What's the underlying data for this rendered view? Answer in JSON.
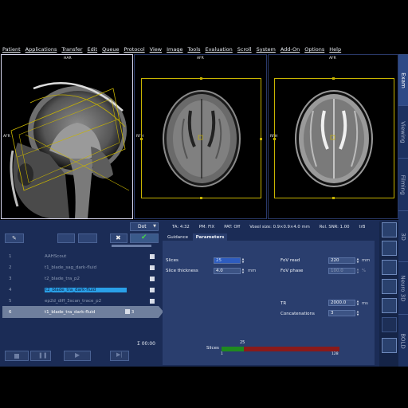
{
  "menu": [
    "Patient",
    "Applications",
    "Transfer",
    "Edit",
    "Queue",
    "Protocol",
    "View",
    "Image",
    "Tools",
    "Evaluation",
    "Scroll",
    "System",
    "Add-On",
    "Options",
    "Help"
  ],
  "viewports": {
    "v1": {
      "top": "HAR",
      "left": "AFR"
    },
    "v2": {
      "top": "AFR",
      "left": "RFH"
    },
    "v3": {
      "top": "AFR",
      "left": "RFH"
    }
  },
  "right_tabs": [
    "Exam",
    "Viewing",
    "Filming",
    "3D",
    "Neuro 3D",
    "BOLD"
  ],
  "queue": {
    "dot_label": "Dot",
    "rows": [
      {
        "num": "1",
        "name": "AAHScout"
      },
      {
        "num": "2",
        "name": "t1_blade_sag_dark-fluid"
      },
      {
        "num": "3",
        "name": "t2_blade_tra_p2"
      },
      {
        "num": "4",
        "name": "t2_blade_tra_dark-fluid"
      },
      {
        "num": "5",
        "name": "ep2d_diff_3scan_trace_p2"
      },
      {
        "num": "6",
        "name": "t1_blade_tra_dark-fluid",
        "suffix": "3"
      }
    ],
    "total_time": "Σ 00:00"
  },
  "status": {
    "ta": "TA: 4:32",
    "pm": "PM: FIX",
    "pat": "PAT: Off",
    "voxel": "Voxel size: 0.9×0.9×4.0 mm",
    "snr": "Rel. SNR: 1.00",
    "seq": "trB"
  },
  "subtabs": {
    "guidance": "Guidance",
    "parameters": "Parameters"
  },
  "params": {
    "slices_label": "Slices",
    "slices_value": "25",
    "thickness_label": "Slice thickness",
    "thickness_value": "4.0",
    "thickness_unit": "mm",
    "fov_read_label": "FoV read",
    "fov_read_value": "220",
    "fov_read_unit": "mm",
    "fov_phase_label": "FoV phase",
    "fov_phase_value": "100.0",
    "fov_phase_unit": "%",
    "tr_label": "TR",
    "tr_value": "2000.0",
    "tr_unit": "ms",
    "conc_label": "Concatenations",
    "conc_value": "3"
  },
  "slider": {
    "label": "Slices",
    "value": "25",
    "min": "1",
    "max": "128",
    "fraction": 0.19
  },
  "colors": {
    "panel": "#1b2c56",
    "accent_yellow": "#c8b400",
    "slider_green": "#1f8a1f",
    "slider_red": "#8a1a1a",
    "highlight": "#2e5cbf"
  }
}
